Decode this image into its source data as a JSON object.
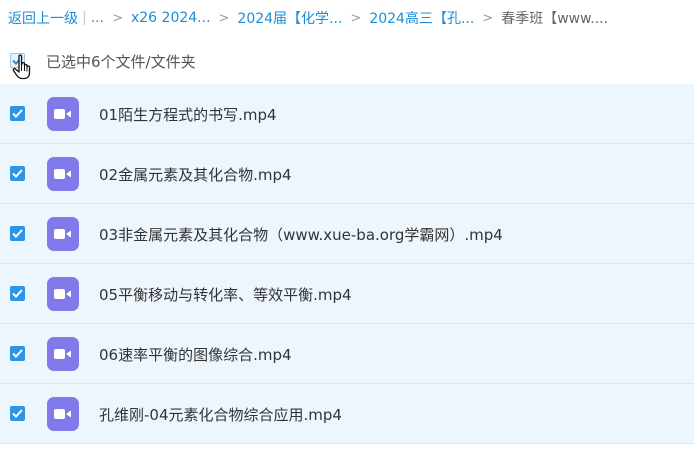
{
  "breadcrumb": {
    "back": "返回上一级",
    "ellipsis": "...",
    "items": [
      "x26 2024...",
      "2024届【化学...",
      "2024高三【孔...",
      "春季班【www...."
    ]
  },
  "selection": {
    "text": "已选中6个文件/文件夹"
  },
  "files": [
    {
      "name": "01陌生方程式的书写.mp4",
      "checked": true
    },
    {
      "name": "02金属元素及其化合物.mp4",
      "checked": true
    },
    {
      "name": "03非金属元素及其化合物（www.xue-ba.org学霸网）.mp4",
      "checked": true
    },
    {
      "name": "05平衡移动与转化率、等效平衡.mp4",
      "checked": true
    },
    {
      "name": "06速率平衡的图像综合.mp4",
      "checked": true
    },
    {
      "name": "孔维刚-04元素化合物综合应用.mp4",
      "checked": true
    }
  ],
  "colors": {
    "link": "#1a8ed8",
    "checkbox": "#2b95e9",
    "video_icon": "#8178ea",
    "row_bg": "#eef6fd"
  },
  "icons": {
    "file_icon": "video-file-icon",
    "check": "checkmark-icon",
    "cursor": "hand-pointer-icon"
  }
}
